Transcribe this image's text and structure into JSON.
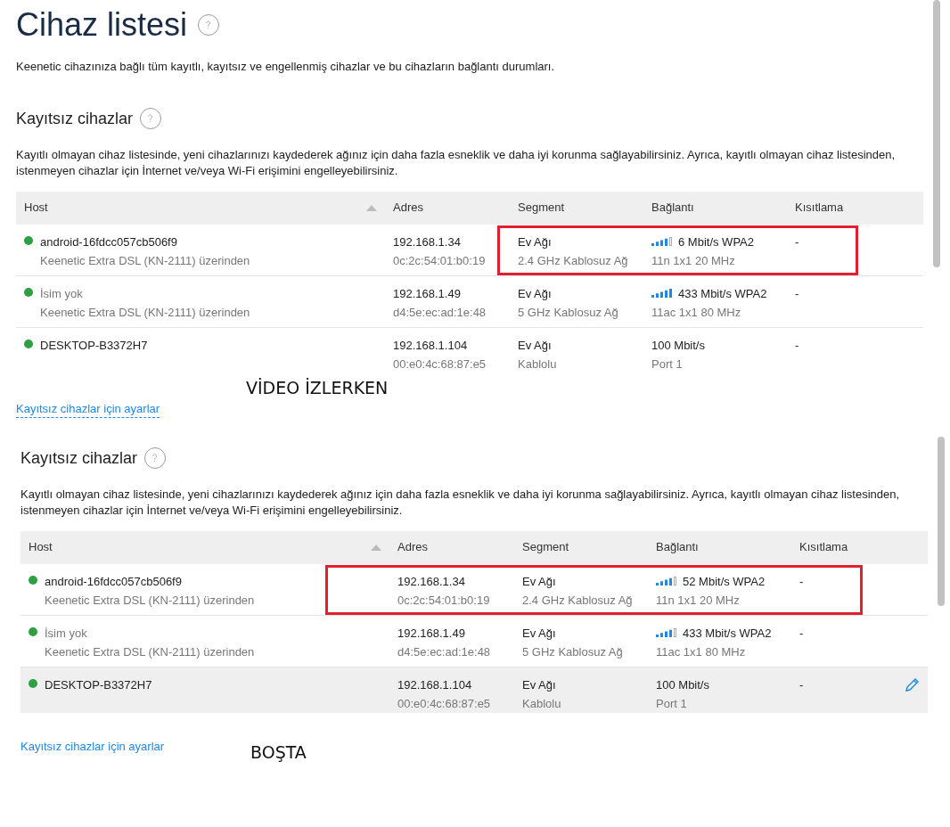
{
  "page": {
    "title": "Cihaz listesi",
    "description": "Keenetic cihazınıza bağlı tüm kayıtlı, kayıtsız ve engellenmiş cihazlar ve bu cihazların bağlantı durumları."
  },
  "panels": [
    {
      "heading": "Kayıtsız cihazlar",
      "description": "Kayıtlı olmayan cihaz listesinde, yeni cihazlarınızı kaydederek ağınız için daha fazla esneklik ve daha iyi korunma sağlayabilirsiniz. Ayrıca, kayıtlı olmayan cihaz listesinden, istenmeyen cihazlar için İnternet ve/veya Wi-Fi erişimini engelleyebilirsiniz.",
      "columns": [
        {
          "label": "Host",
          "sorted": true
        },
        {
          "label": "Adres",
          "sorted": false
        },
        {
          "label": "Segment",
          "sorted": false
        },
        {
          "label": "Bağlantı",
          "sorted": false
        },
        {
          "label": "Kısıtlama",
          "sorted": false
        }
      ],
      "rows": [
        {
          "online": true,
          "unnamed": false,
          "hovered": false,
          "highlighted": true,
          "highlight_includes_address": false,
          "host": "android-16fdcc057cb506f9",
          "via": "Keenetic Extra DSL (KN-2111) üzerinden",
          "address": "192.168.1.34",
          "mac": "0c:2c:54:01:b0:19",
          "segment": "Ev Ağı",
          "segment_type": "2.4 GHz Kablosuz Ağ",
          "kind": "wireless",
          "signal_full": false,
          "connection": "6 Mbit/s WPA2",
          "connection_detail": "11n 1x1 20 MHz",
          "restriction": "-"
        },
        {
          "online": true,
          "unnamed": true,
          "hovered": false,
          "highlighted": false,
          "host": "İsim yok",
          "via": "Keenetic Extra DSL (KN-2111) üzerinden",
          "address": "192.168.1.49",
          "mac": "d4:5e:ec:ad:1e:48",
          "segment": "Ev Ağı",
          "segment_type": "5 GHz Kablosuz Ağ",
          "kind": "wireless",
          "signal_full": true,
          "connection": "433 Mbit/s WPA2",
          "connection_detail": "11ac 1x1 80 MHz",
          "restriction": "-"
        },
        {
          "online": true,
          "unnamed": false,
          "hovered": false,
          "highlighted": false,
          "host": "DESKTOP-B3372H7",
          "address": "192.168.1.104",
          "mac": "00:e0:4c:68:87:e5",
          "segment": "Ev Ağı",
          "segment_type": "Kablolu",
          "kind": "wired",
          "connection": "100 Mbit/s",
          "connection_detail": "Port 1",
          "restriction": "-"
        }
      ],
      "annotation": "VİDEO İZLERKEN",
      "settings_link": "Kayıtsız cihazlar için ayarlar",
      "link_underlined": true
    },
    {
      "heading": "Kayıtsız cihazlar",
      "description": "Kayıtlı olmayan cihaz listesinde, yeni cihazlarınızı kaydederek ağınız için daha fazla esneklik ve daha iyi korunma sağlayabilirsiniz. Ayrıca, kayıtlı olmayan cihaz listesinden, istenmeyen cihazlar için İnternet ve/veya Wi-Fi erişimini engelleyebilirsiniz.",
      "columns": [
        {
          "label": "Host",
          "sorted": true
        },
        {
          "label": "Adres",
          "sorted": false
        },
        {
          "label": "Segment",
          "sorted": false
        },
        {
          "label": "Bağlantı",
          "sorted": false
        },
        {
          "label": "Kısıtlama",
          "sorted": false
        }
      ],
      "rows": [
        {
          "online": true,
          "unnamed": false,
          "hovered": false,
          "highlighted": true,
          "highlight_includes_address": true,
          "host": "android-16fdcc057cb506f9",
          "via": "Keenetic Extra DSL (KN-2111) üzerinden",
          "address": "192.168.1.34",
          "mac": "0c:2c:54:01:b0:19",
          "segment": "Ev Ağı",
          "segment_type": "2.4 GHz Kablosuz Ağ",
          "kind": "wireless",
          "signal_full": false,
          "connection": "52 Mbit/s WPA2",
          "connection_detail": "11n 1x1 20 MHz",
          "restriction": "-"
        },
        {
          "online": true,
          "unnamed": true,
          "hovered": false,
          "highlighted": false,
          "host": "İsim yok",
          "via": "Keenetic Extra DSL (KN-2111) üzerinden",
          "address": "192.168.1.49",
          "mac": "d4:5e:ec:ad:1e:48",
          "segment": "Ev Ağı",
          "segment_type": "5 GHz Kablosuz Ağ",
          "kind": "wireless",
          "signal_full": false,
          "connection": "433 Mbit/s WPA2",
          "connection_detail": "11ac 1x1 80 MHz",
          "restriction": "-"
        },
        {
          "online": true,
          "unnamed": false,
          "hovered": true,
          "highlighted": false,
          "host": "DESKTOP-B3372H7",
          "address": "192.168.1.104",
          "mac": "00:e0:4c:68:87:e5",
          "segment": "Ev Ağı",
          "segment_type": "Kablolu",
          "kind": "wired",
          "connection": "100 Mbit/s",
          "connection_detail": "Port 1",
          "restriction": "-"
        }
      ],
      "annotation": "BOŞTA",
      "settings_link": "Kayıtsız cihazlar için ayarlar",
      "link_underlined": false
    }
  ]
}
